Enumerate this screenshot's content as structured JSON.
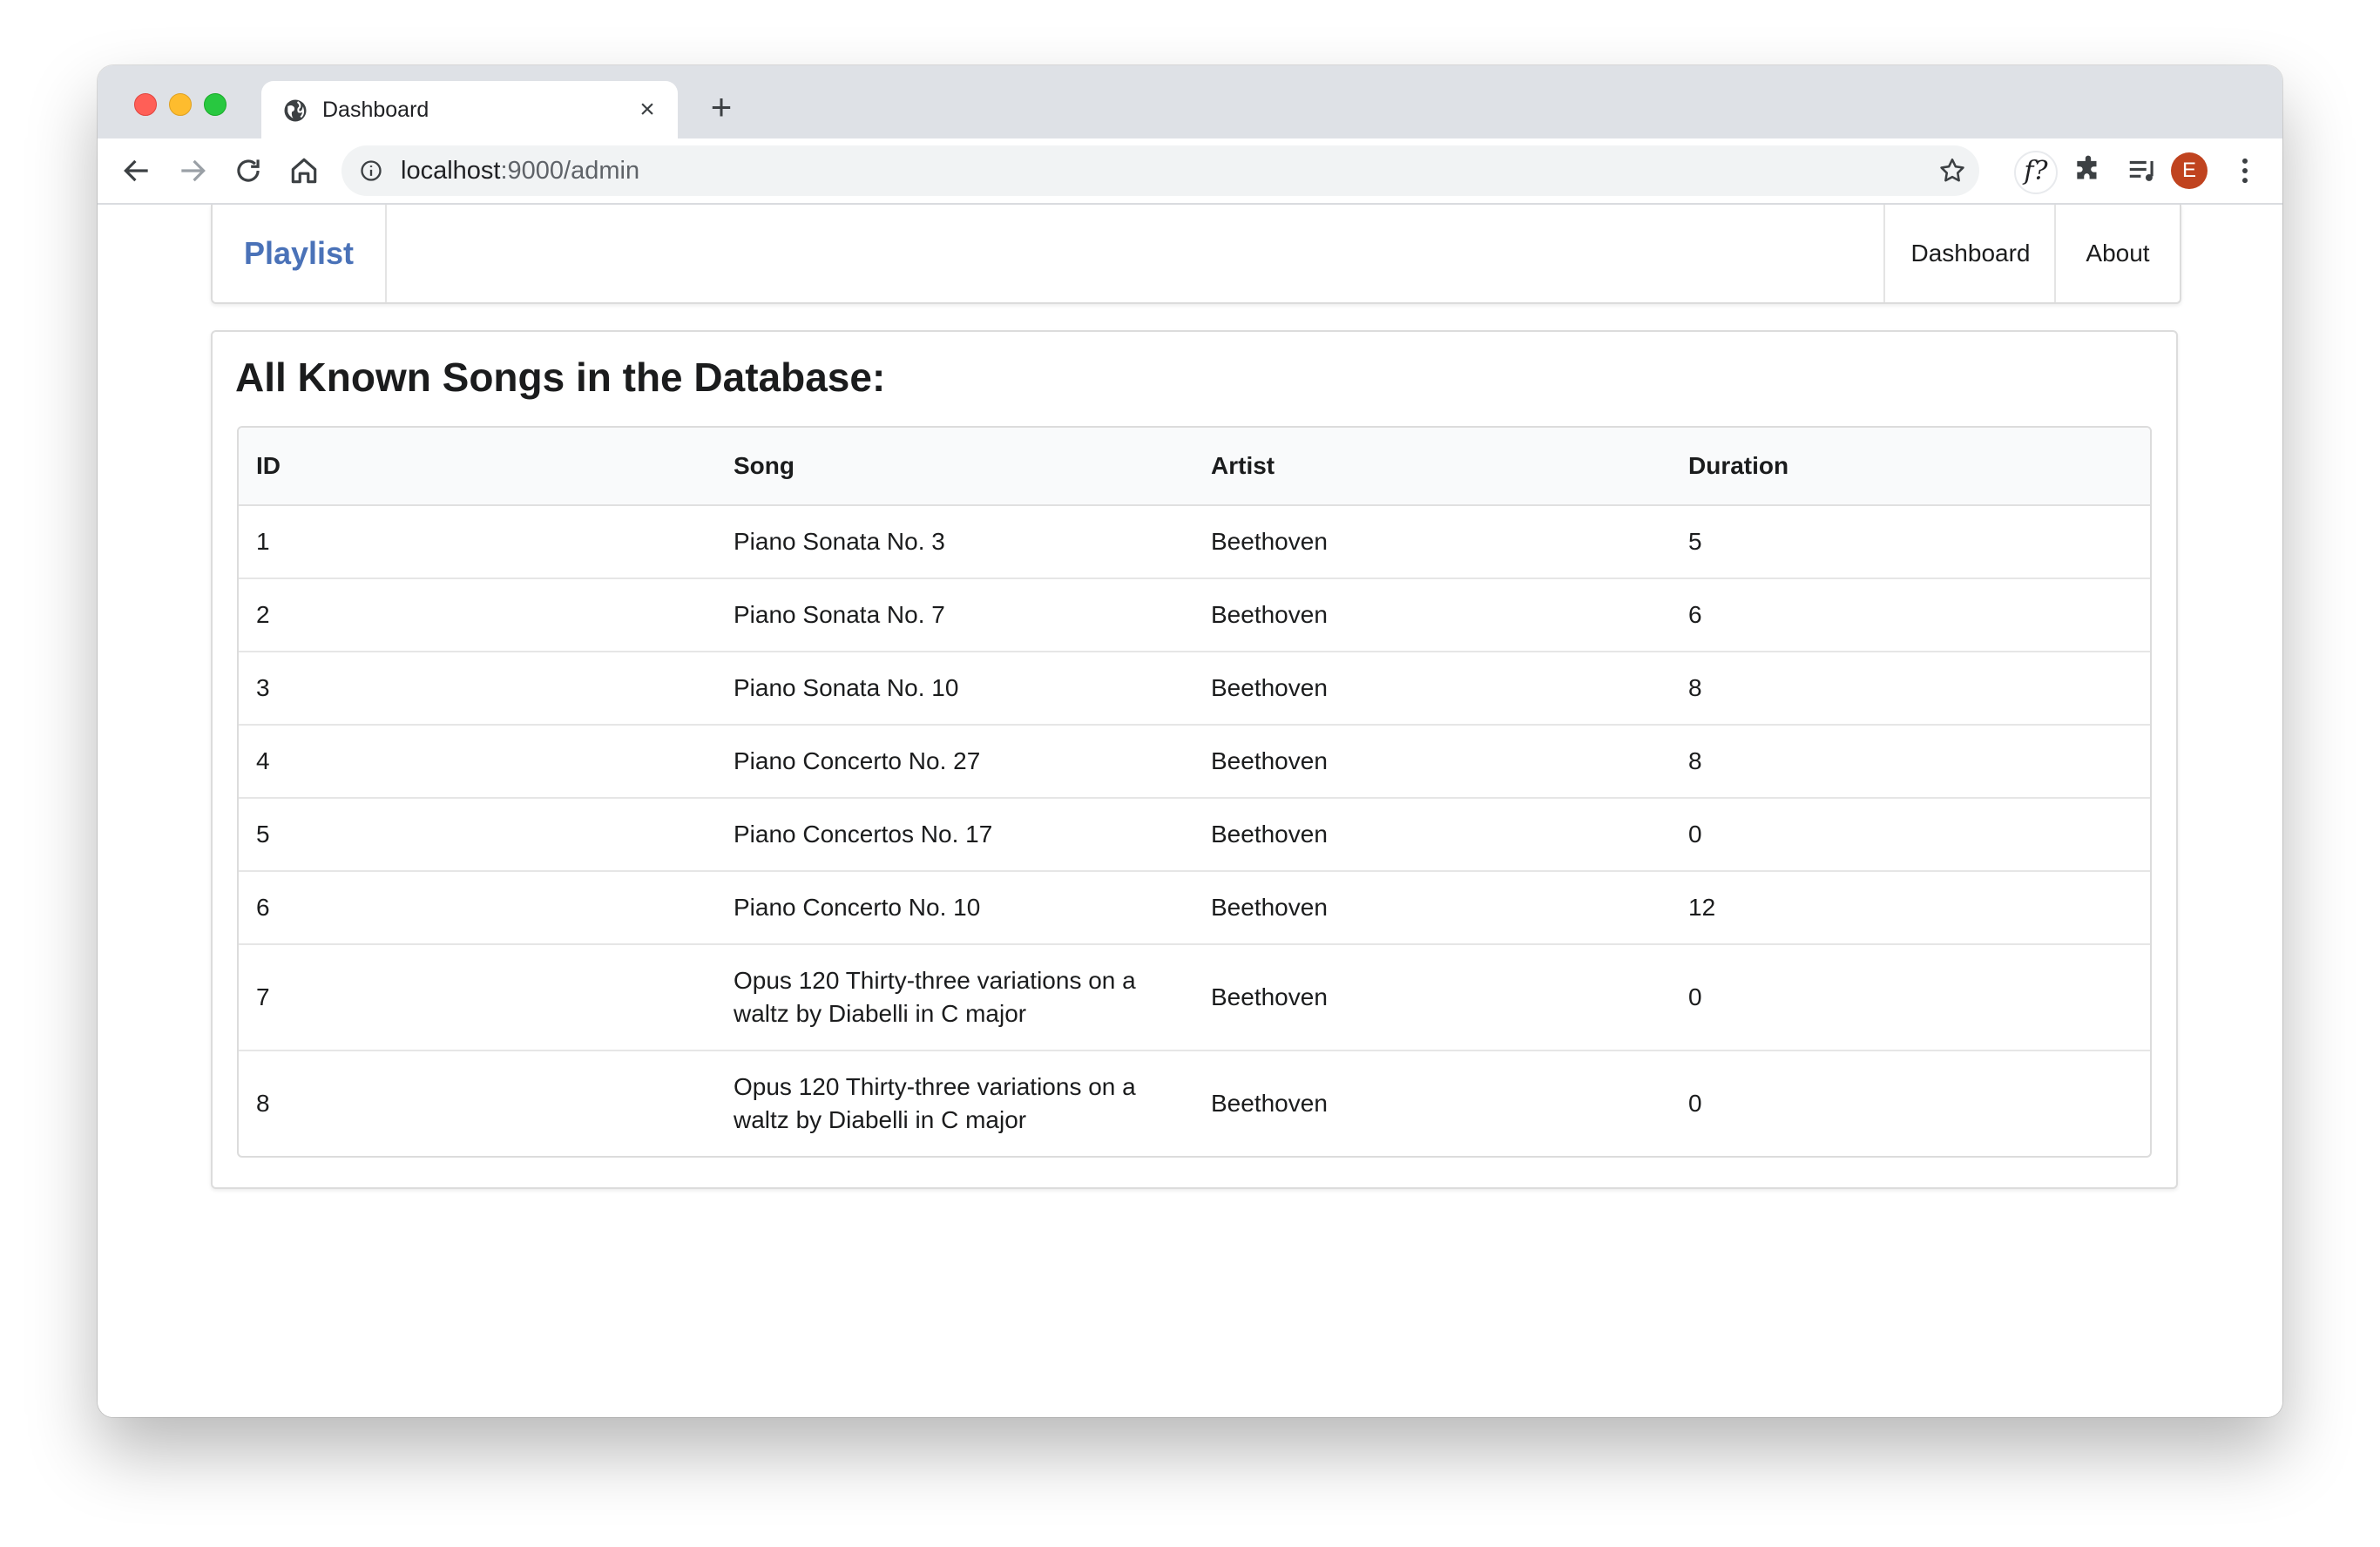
{
  "browser": {
    "tab_title": "Dashboard",
    "url_host": "localhost",
    "url_rest": ":9000/admin",
    "avatar_letter": "E",
    "ext_f_label": "f?"
  },
  "navbar": {
    "brand": "Playlist",
    "items": [
      {
        "label": "Dashboard"
      },
      {
        "label": "About"
      }
    ]
  },
  "main": {
    "title": "All Known Songs in the Database:",
    "columns": [
      "ID",
      "Song",
      "Artist",
      "Duration"
    ],
    "rows": [
      {
        "id": "1",
        "song": "Piano Sonata No. 3",
        "artist": "Beethoven",
        "duration": "5"
      },
      {
        "id": "2",
        "song": "Piano Sonata No. 7",
        "artist": "Beethoven",
        "duration": "6"
      },
      {
        "id": "3",
        "song": "Piano Sonata No. 10",
        "artist": "Beethoven",
        "duration": "8"
      },
      {
        "id": "4",
        "song": "Piano Concerto No. 27",
        "artist": "Beethoven",
        "duration": "8"
      },
      {
        "id": "5",
        "song": "Piano Concertos No. 17",
        "artist": "Beethoven",
        "duration": "0"
      },
      {
        "id": "6",
        "song": "Piano Concerto No. 10",
        "artist": "Beethoven",
        "duration": "12"
      },
      {
        "id": "7",
        "song": "Opus 120 Thirty-three variations on a waltz by Diabelli in C major",
        "artist": "Beethoven",
        "duration": "0"
      },
      {
        "id": "8",
        "song": "Opus 120 Thirty-three variations on a waltz by Diabelli in C major",
        "artist": "Beethoven",
        "duration": "0"
      }
    ]
  },
  "colors": {
    "brand": "#4a72b8",
    "avatar": "#c0431f",
    "tabstrip": "#dee1e6"
  },
  "icons": {
    "tab": "globe-icon",
    "back": "arrow-left-icon",
    "forward": "arrow-right-icon",
    "reload": "reload-icon",
    "home": "home-icon",
    "info": "info-icon",
    "bookmark": "star-icon",
    "extensions": "puzzle-icon",
    "media": "media-queue-icon",
    "menu": "kebab-menu-icon"
  }
}
